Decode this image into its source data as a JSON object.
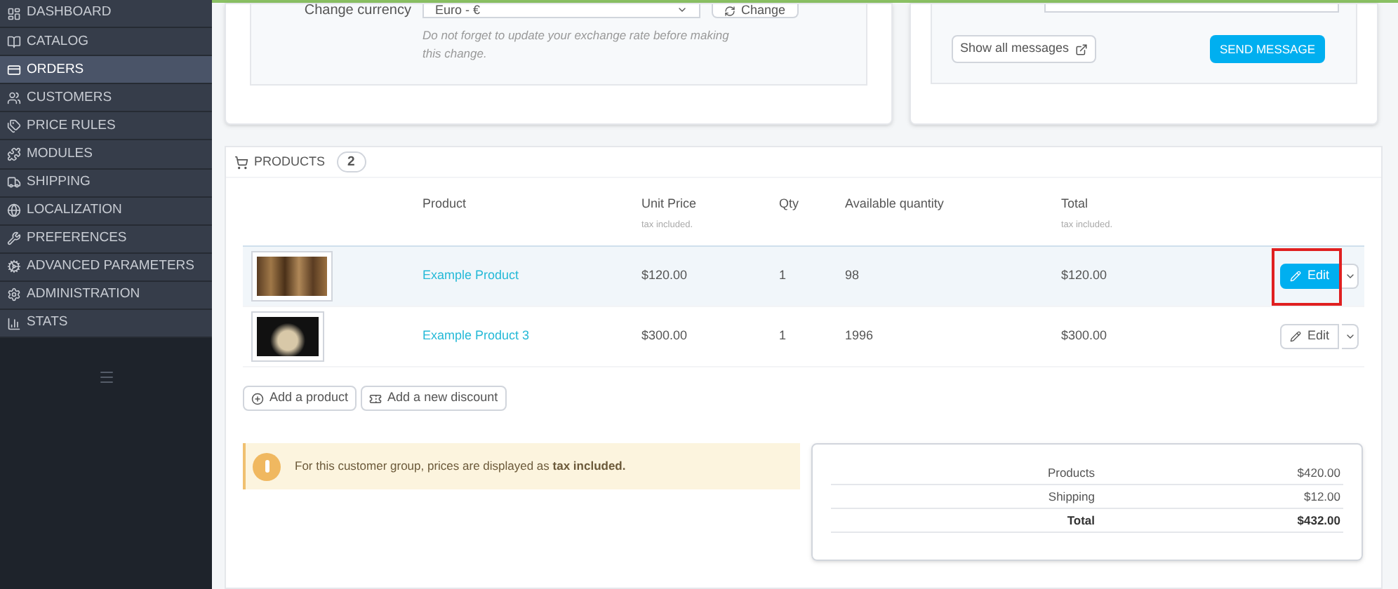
{
  "sidebar": {
    "items": [
      {
        "label": "DASHBOARD",
        "selected": false
      },
      {
        "label": "CATALOG",
        "selected": false
      },
      {
        "label": "ORDERS",
        "selected": true
      },
      {
        "label": "CUSTOMERS",
        "selected": false
      },
      {
        "label": "PRICE RULES",
        "selected": false
      },
      {
        "label": "MODULES",
        "selected": false
      },
      {
        "label": "SHIPPING",
        "selected": false
      },
      {
        "label": "LOCALIZATION",
        "selected": false
      },
      {
        "label": "PREFERENCES",
        "selected": false
      },
      {
        "label": "ADVANCED PARAMETERS",
        "selected": false
      },
      {
        "label": "ADMINISTRATION",
        "selected": false
      },
      {
        "label": "STATS",
        "selected": false
      }
    ]
  },
  "currency": {
    "label": "Change currency",
    "value": "Euro - €",
    "button": "Change",
    "hint": "Do not forget to update your exchange rate before making this change."
  },
  "messages": {
    "show_all": "Show all messages",
    "send": "SEND MESSAGE"
  },
  "products": {
    "title": "PRODUCTS",
    "count": "2",
    "columns": [
      {
        "label": "Product"
      },
      {
        "label": "Unit Price",
        "note": "tax included."
      },
      {
        "label": "Qty"
      },
      {
        "label": "Available quantity"
      },
      {
        "label": "Total",
        "note": "tax included."
      }
    ],
    "rows": [
      {
        "name": "Example Product",
        "unit_price": "$120.00",
        "qty": "1",
        "available": "98",
        "total": "$120.00",
        "edit": "Edit",
        "selected": true,
        "annotated": true
      },
      {
        "name": "Example Product 3",
        "unit_price": "$300.00",
        "qty": "1",
        "available": "1996",
        "total": "$300.00",
        "edit": "Edit",
        "selected": false,
        "annotated": false
      }
    ],
    "actions": [
      "Add a product",
      "Add a new discount"
    ]
  },
  "notice": {
    "text": "For this customer group, prices are displayed as **tax included.**"
  },
  "totals": [
    {
      "label": "Products",
      "value": "$420.00",
      "bold": false
    },
    {
      "label": "Shipping",
      "value": "$12.00",
      "bold": false
    },
    {
      "label": "Total",
      "value": "$432.00",
      "bold": true
    }
  ]
}
